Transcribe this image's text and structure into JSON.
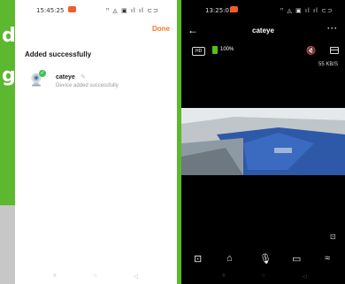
{
  "background_color": "#5cb82e",
  "left_strip": {
    "chars": [
      "d",
      "g"
    ]
  },
  "phone1": {
    "status": {
      "time": "15:45:25",
      "icons": "ᵸ ◬ ▣ ıl ıl ⊂⊃"
    },
    "done_label": "Done",
    "title": "Added successfully",
    "device": {
      "name": "cateye",
      "status": "Device added successfully",
      "icon": "camera-icon",
      "badge": "✓"
    },
    "nav": [
      "≡",
      "○",
      "◁"
    ]
  },
  "phone2": {
    "status": {
      "time": "13:25:01",
      "icons": "ᵸ ◬ ▣ ıl ıl ⊂⊃"
    },
    "title": "cateye",
    "back_icon": "←",
    "more_icon": "···",
    "hd_label": "HD",
    "battery": 1.0,
    "battery_label": "100%",
    "mute_icon": "🔇",
    "speed": "55 KB/S",
    "controls": [
      "screenshot-icon",
      "camera-icon",
      "mic-icon",
      "record-icon",
      "expand-icon"
    ],
    "nav": [
      "≡",
      "○",
      "◁"
    ]
  }
}
